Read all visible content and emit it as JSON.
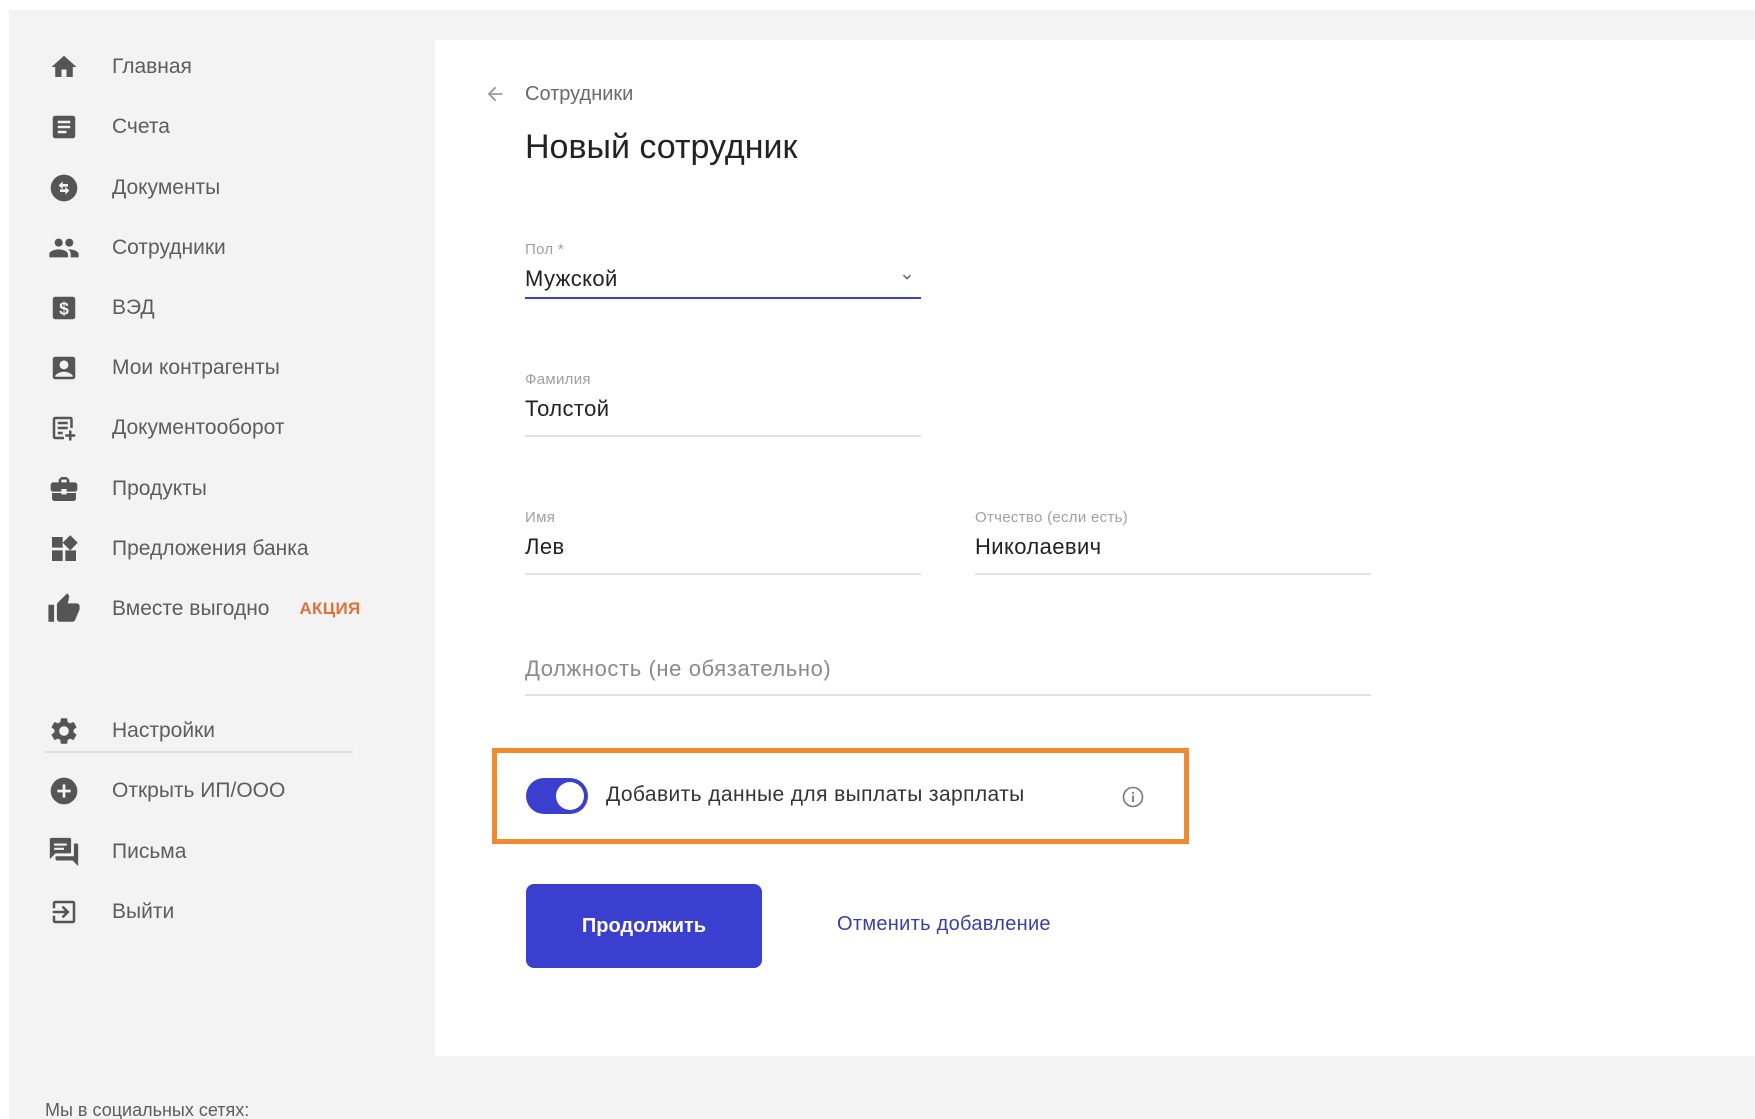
{
  "sidebar": {
    "items": [
      {
        "label": "Главная",
        "icon": "home-icon"
      },
      {
        "label": "Счета",
        "icon": "accounts-icon"
      },
      {
        "label": "Документы",
        "icon": "documents-icon"
      },
      {
        "label": "Сотрудники",
        "icon": "people-icon"
      },
      {
        "label": "ВЭД",
        "icon": "dollar-icon"
      },
      {
        "label": "Мои контрагенты",
        "icon": "contact-card-icon"
      },
      {
        "label": "Документооборот",
        "icon": "document-add-icon"
      },
      {
        "label": "Продукты",
        "icon": "briefcase-icon"
      },
      {
        "label": "Предложения банка",
        "icon": "widgets-icon"
      },
      {
        "label": "Вместе выгодно",
        "icon": "thumb-up-icon",
        "badge": "АКЦИЯ"
      }
    ],
    "bottom_items": [
      {
        "label": "Настройки",
        "icon": "gear-icon"
      },
      {
        "label": "Открыть ИП/ООО",
        "icon": "plus-circle-icon"
      },
      {
        "label": "Письма",
        "icon": "messages-icon"
      },
      {
        "label": "Выйти",
        "icon": "logout-icon"
      }
    ],
    "social_label": "Мы в социальных сетях:"
  },
  "main": {
    "breadcrumb": "Сотрудники",
    "title": "Новый сотрудник",
    "fields": {
      "gender": {
        "label": "Пол *",
        "value": "Мужской"
      },
      "last_name": {
        "label": "Фамилия",
        "value": "Толстой"
      },
      "first_name": {
        "label": "Имя",
        "value": "Лев"
      },
      "patronymic": {
        "label": "Отчество (если есть)",
        "value": "Николаевич"
      },
      "position": {
        "placeholder": "Должность (не обязательно)",
        "value": ""
      }
    },
    "salary_toggle": {
      "label": "Добавить данные для выплаты зарплаты",
      "enabled": true
    },
    "continue_button": "Продолжить",
    "cancel_link": "Отменить добавление"
  },
  "colors": {
    "accent": "#3a3fcf",
    "highlight": "#f08b32",
    "badge": "#e0703a",
    "sidebar_bg": "#f3f3f3"
  }
}
